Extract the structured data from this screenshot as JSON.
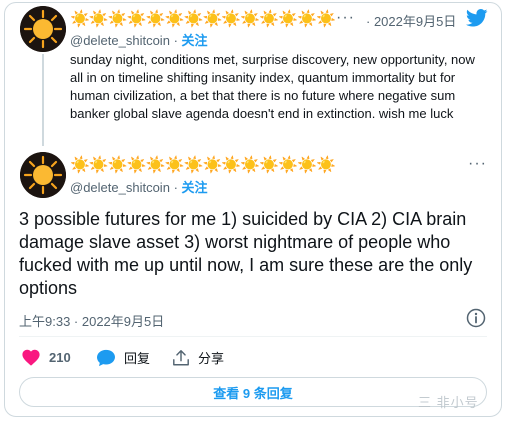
{
  "quoted_tweet": {
    "display_name": "☀️☀️☀️☀️☀️☀️☀️☀️☀️☀️☀️☀️☀️☀️",
    "handle": "@delete_shitcoin",
    "separator": "·",
    "follow_label": "关注",
    "date": "· 2022年9月5日",
    "text": "sunday night, conditions met, surprise discovery, new opportunity, now all in on timeline shifting insanity index, quantum immortality but for human civilization, a bet that there is no future where negative sum banker global slave agenda doesn't end in extinction. wish me luck"
  },
  "main_tweet": {
    "display_name": "☀️☀️☀️☀️☀️☀️☀️☀️☀️☀️☀️☀️☀️☀️",
    "handle": "@delete_shitcoin",
    "separator": "·",
    "follow_label": "关注",
    "text": "3 possible futures for me 1) suicided by CIA  2) CIA brain damage slave asset  3) worst nightmare of people who fucked with me up until now, I am sure these are the only options",
    "timestamp": "上午9:33 · 2022年9月5日"
  },
  "actions": {
    "like_count": "210",
    "reply_label": "回复",
    "share_label": "分享"
  },
  "replies_button_label": "查看 9 条回复",
  "watermark": "三 非小号",
  "colors": {
    "accent": "#1d9bf0",
    "like": "#f91880",
    "name_sun": "#f7a41d",
    "muted": "#536471"
  }
}
